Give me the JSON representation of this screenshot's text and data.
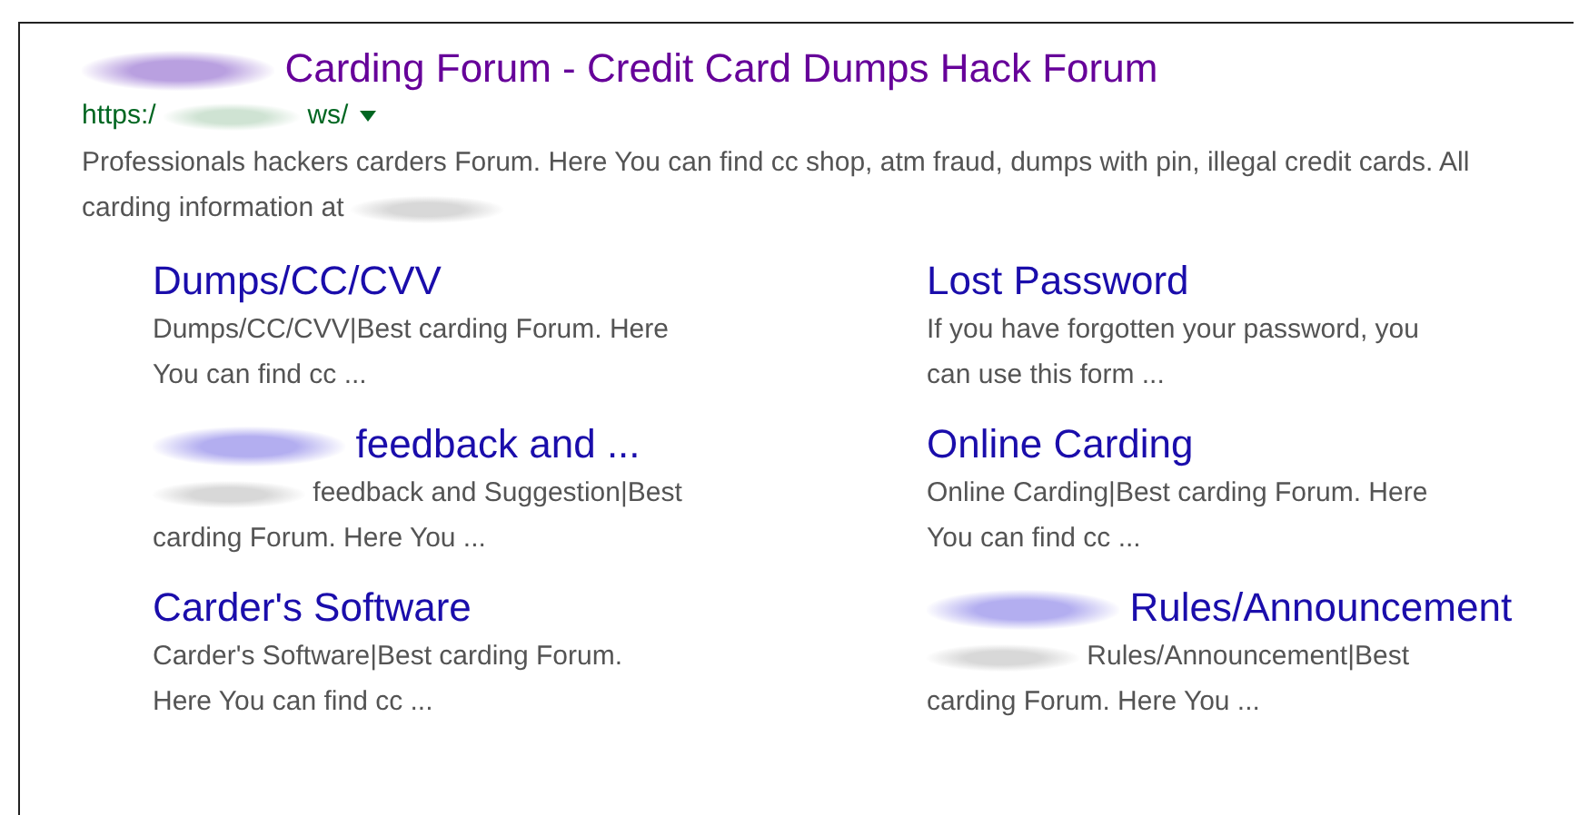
{
  "result": {
    "title": {
      "visited": true,
      "parts": [
        {
          "kind": "blur"
        },
        {
          "kind": "text",
          "text": "Carding Forum - Credit Card Dumps Hack Forum"
        }
      ]
    },
    "url": {
      "parts": [
        {
          "kind": "text",
          "text": "https:/"
        },
        {
          "kind": "blur"
        },
        {
          "kind": "text",
          "text": "ws/"
        }
      ],
      "has_menu": true
    },
    "snippet": {
      "parts": [
        {
          "kind": "text",
          "text": "Professionals hackers carders Forum. Here You can find cc shop, atm fraud, dumps with pin, illegal credit cards. All carding information at"
        },
        {
          "kind": "blur"
        }
      ]
    },
    "sitelinks": [
      {
        "title": [
          {
            "kind": "text",
            "text": "Dumps/CC/CVV"
          }
        ],
        "snippet": [
          {
            "kind": "text",
            "text": "Dumps/CC/CVV|Best carding Forum. Here You can find cc ..."
          }
        ]
      },
      {
        "title": [
          {
            "kind": "text",
            "text": "Lost Password"
          }
        ],
        "snippet": [
          {
            "kind": "text",
            "text": "If you have forgotten your password, you can use this form ..."
          }
        ]
      },
      {
        "title": [
          {
            "kind": "blur"
          },
          {
            "kind": "text",
            "text": "feedback and ..."
          }
        ],
        "snippet": [
          {
            "kind": "blur"
          },
          {
            "kind": "text",
            "text": "feedback and Suggestion|Best carding Forum. Here You ..."
          }
        ]
      },
      {
        "title": [
          {
            "kind": "text",
            "text": "Online Carding"
          }
        ],
        "snippet": [
          {
            "kind": "text",
            "text": "Online Carding|Best carding Forum. Here You can find cc ..."
          }
        ]
      },
      {
        "title": [
          {
            "kind": "text",
            "text": "Carder's Software"
          }
        ],
        "snippet": [
          {
            "kind": "text",
            "text": "Carder's Software|Best carding Forum. Here You can find cc ..."
          }
        ]
      },
      {
        "title": [
          {
            "kind": "blur"
          },
          {
            "kind": "text",
            "text": "Rules/Announcement"
          }
        ],
        "snippet": [
          {
            "kind": "blur"
          },
          {
            "kind": "text",
            "text": "Rules/Announcement|Best carding Forum. Here You ..."
          }
        ]
      }
    ]
  }
}
